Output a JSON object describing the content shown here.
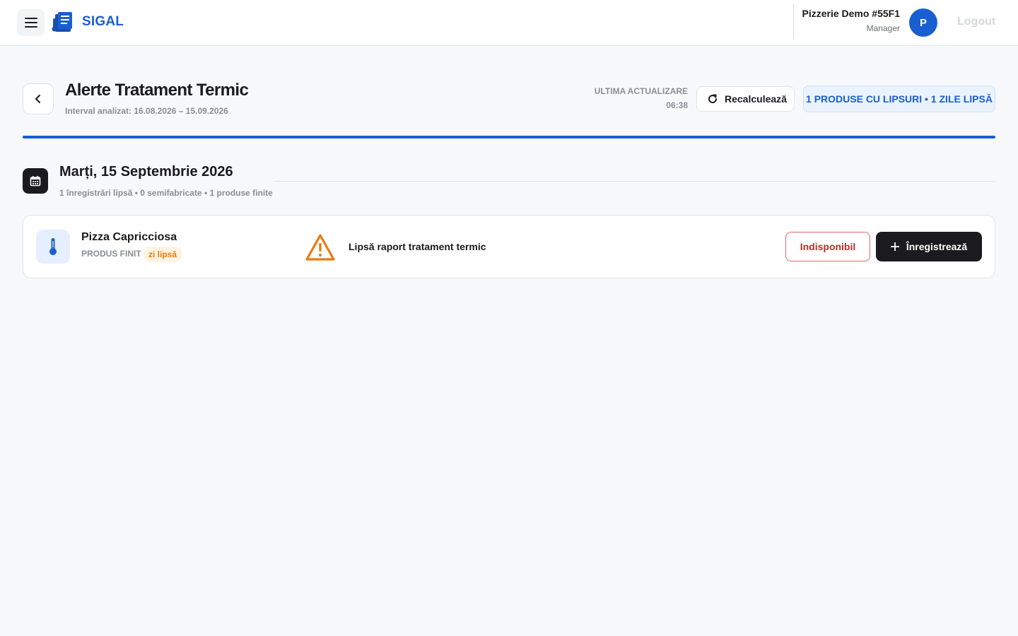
{
  "header": {
    "brand": "SIGAL",
    "org_name": "Pizzerie Demo #55F1",
    "org_role": "Manager",
    "avatar_initial": "P",
    "logout_label": "Logout"
  },
  "page": {
    "title": "Alerte Tratament Termic",
    "subtitle": "Interval analizat: 16.08.2026 – 15.09.2026",
    "last_update_label": "ULTIMA ACTUALIZARE",
    "last_update_time": "06:38",
    "recalc_label": "Recalculează",
    "summary_badge": "1 PRODUSE CU LIPSURI • 1 ZILE LIPSĂ"
  },
  "day": {
    "title": "Marți, 15 Septembrie 2026",
    "stats": "1 înregistrări lipsă • 0 semifabricate • 1 produse finite"
  },
  "alert": {
    "product_name": "Pizza Capricciosa",
    "product_type": "PRODUS FINIT",
    "tag": "zi lipsă",
    "message": "Lipsă raport tratament termic",
    "unavailable_label": "Indisponibil",
    "register_label": "Înregistrează"
  },
  "colors": {
    "accent": "#1a5fd1",
    "warning": "#ea7a10",
    "danger": "#c62828",
    "dark": "#1b1b1f"
  },
  "icons": {
    "menu": "hamburger-icon",
    "logo": "document-thermometer-icon",
    "back": "chevron-left-icon",
    "recalc": "refresh-icon",
    "calendar": "calendar-icon",
    "product": "thermometer-icon",
    "warning": "warning-triangle-icon",
    "register": "plus-icon"
  }
}
